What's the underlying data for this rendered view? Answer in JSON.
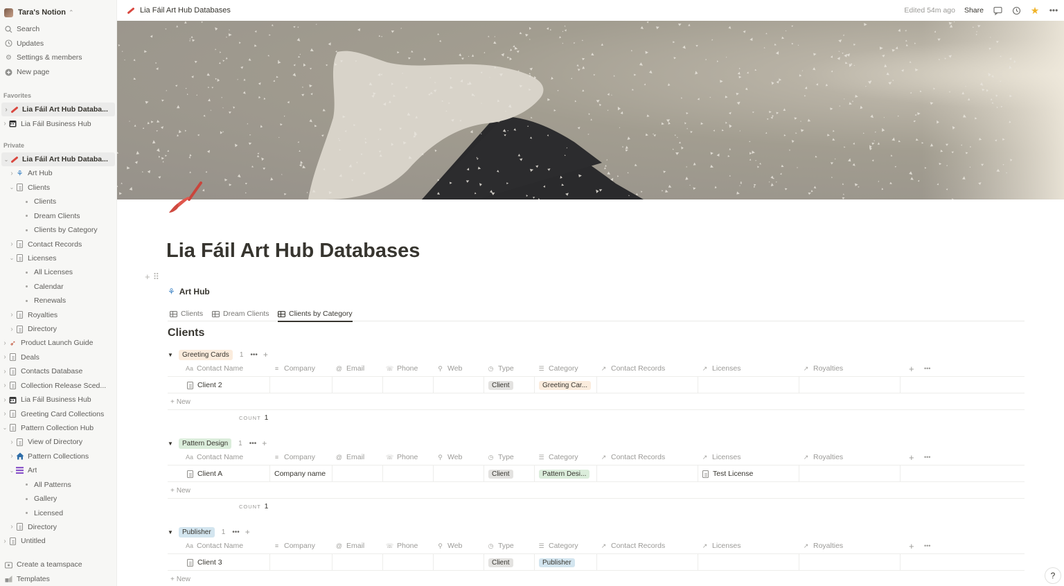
{
  "workspace": {
    "name": "Tara's Notion"
  },
  "sidebar": {
    "top_items": [
      {
        "label": "Search",
        "icon": "search-icon"
      },
      {
        "label": "Updates",
        "icon": "clock-icon"
      },
      {
        "label": "Settings & members",
        "icon": "gear-icon"
      },
      {
        "label": "New page",
        "icon": "plus-circle-icon"
      }
    ],
    "favorites_label": "Favorites",
    "favorites": [
      {
        "label": "Lia Fáil Art Hub Databa...",
        "icon": "paintbrush-icon",
        "selected": true
      },
      {
        "label": "Lia Fáil Business Hub",
        "icon": "calendar-icon"
      }
    ],
    "private_label": "Private",
    "private": [
      {
        "label": "Lia Fáil Art Hub Databa...",
        "icon": "paintbrush-icon",
        "level": 0,
        "selected": true,
        "expanded": true
      },
      {
        "label": "Art Hub",
        "icon": "art-hub-icon",
        "level": 1
      },
      {
        "label": "Clients",
        "icon": "page-icon",
        "level": 1,
        "expanded": true
      },
      {
        "label": "Clients",
        "icon": "dot",
        "level": 2
      },
      {
        "label": "Dream Clients",
        "icon": "dot",
        "level": 2
      },
      {
        "label": "Clients by Category",
        "icon": "dot",
        "level": 2
      },
      {
        "label": "Contact Records",
        "icon": "page-icon",
        "level": 1
      },
      {
        "label": "Licenses",
        "icon": "page-icon",
        "level": 1,
        "expanded": true
      },
      {
        "label": "All Licenses",
        "icon": "dot",
        "level": 2
      },
      {
        "label": "Calendar",
        "icon": "dot",
        "level": 2
      },
      {
        "label": "Renewals",
        "icon": "dot",
        "level": 2
      },
      {
        "label": "Royalties",
        "icon": "page-icon",
        "level": 1
      },
      {
        "label": "Directory",
        "icon": "page-icon",
        "level": 1
      },
      {
        "label": "Product Launch Guide",
        "icon": "rocket-icon",
        "level": 0
      },
      {
        "label": "Deals",
        "icon": "page-icon",
        "level": 0
      },
      {
        "label": "Contacts Database",
        "icon": "page-icon",
        "level": 0
      },
      {
        "label": "Collection Release Sced...",
        "icon": "page-icon",
        "level": 0
      },
      {
        "label": "Lia Fáil Business Hub",
        "icon": "calendar-icon",
        "level": 0
      },
      {
        "label": "Greeting Card Collections",
        "icon": "page-icon",
        "level": 0
      },
      {
        "label": "Pattern Collection Hub",
        "icon": "page-icon",
        "level": 0,
        "expanded": true
      },
      {
        "label": "View of Directory",
        "icon": "linked-page-icon",
        "level": 1
      },
      {
        "label": "Pattern Collections",
        "icon": "house-icon",
        "level": 1
      },
      {
        "label": "Art",
        "icon": "list-icon",
        "level": 1,
        "expanded": true
      },
      {
        "label": "All Patterns",
        "icon": "dot",
        "level": 2
      },
      {
        "label": "Gallery",
        "icon": "dot",
        "level": 2
      },
      {
        "label": "Licensed",
        "icon": "dot",
        "level": 2
      },
      {
        "label": "Directory",
        "icon": "page-icon",
        "level": 1
      },
      {
        "label": "Untitled",
        "icon": "page-icon",
        "level": 0
      }
    ],
    "bottom_items": [
      {
        "label": "Create a teamspace",
        "icon": "teamspace-icon"
      },
      {
        "label": "Templates",
        "icon": "templates-icon"
      }
    ]
  },
  "topbar": {
    "breadcrumb": "Lia Fáil Art Hub Databases",
    "edited": "Edited 54m ago",
    "share": "Share"
  },
  "page": {
    "title": "Lia Fáil Art Hub Databases",
    "database_title": "Art Hub",
    "tabs": [
      {
        "label": "Clients",
        "active": false
      },
      {
        "label": "Dream Clients",
        "active": false
      },
      {
        "label": "Clients by Category",
        "active": true
      }
    ],
    "view_title": "Clients"
  },
  "table": {
    "columns": [
      {
        "label": "Contact Name",
        "icon": "Aa"
      },
      {
        "label": "Company",
        "icon": "≡"
      },
      {
        "label": "Email",
        "icon": "@"
      },
      {
        "label": "Phone",
        "icon": "☏"
      },
      {
        "label": "Web",
        "icon": "⚲"
      },
      {
        "label": "Type",
        "icon": "◷"
      },
      {
        "label": "Category",
        "icon": "☰"
      },
      {
        "label": "Contact Records",
        "icon": "↗"
      },
      {
        "label": "Licenses",
        "icon": "↗"
      },
      {
        "label": "Royalties",
        "icon": "↗"
      }
    ],
    "new_label": "New",
    "count_label": "COUNT",
    "groups": [
      {
        "name": "Greeting Cards",
        "tag_bg": "#fbecdd",
        "count": "1",
        "rows": [
          {
            "name": "Client 2",
            "company": "",
            "type": "Client",
            "category": "Greeting Car...",
            "category_bg": "#fbecdd",
            "licenses": ""
          }
        ],
        "count_value": "1"
      },
      {
        "name": "Pattern Design",
        "tag_bg": "#dbeddb",
        "count": "1",
        "rows": [
          {
            "name": "Client A",
            "company": "Company name",
            "type": "Client",
            "category": "Pattern Desi...",
            "category_bg": "#dbeddb",
            "licenses": "Test License"
          }
        ],
        "count_value": "1"
      },
      {
        "name": "Publisher",
        "tag_bg": "#d3e5ef",
        "count": "1",
        "rows": [
          {
            "name": "Client 3",
            "company": "",
            "type": "Client",
            "category": "Publisher",
            "category_bg": "#d3e5ef",
            "licenses": ""
          }
        ],
        "count_value": ""
      }
    ]
  },
  "colors": {
    "accent": "#d9473f",
    "star": "#f0b429",
    "sidebar_bg": "#f7f7f5"
  }
}
